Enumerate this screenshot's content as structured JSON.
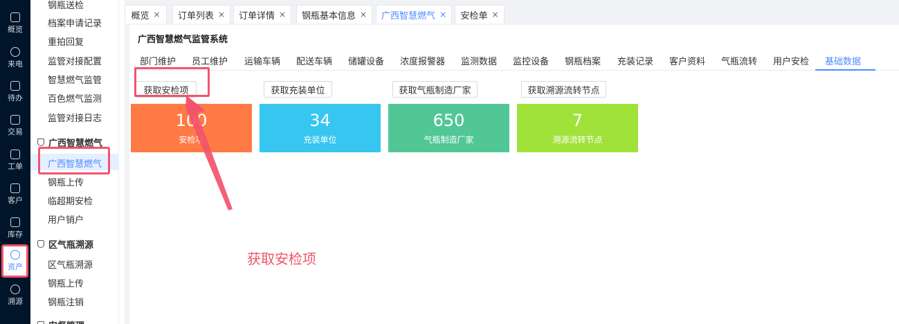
{
  "rail": {
    "items": [
      {
        "label": "概览",
        "icon": "chart-icon"
      },
      {
        "label": "来电",
        "icon": "phone-icon"
      },
      {
        "label": "待办",
        "icon": "todo-icon"
      },
      {
        "label": "交易",
        "icon": "bag-icon"
      },
      {
        "label": "工单",
        "icon": "ticket-icon"
      },
      {
        "label": "客户",
        "icon": "id-card-icon"
      },
      {
        "label": "库存",
        "icon": "inventory-icon"
      },
      {
        "label": "资产",
        "icon": "lightbulb-icon"
      },
      {
        "label": "溯源",
        "icon": "compass-icon"
      }
    ]
  },
  "submenu": {
    "top_items": [
      "钢瓶送检",
      "档案申请记录",
      "重拍回复",
      "监管对接配置",
      "智慧燃气监管",
      "百色燃气监测",
      "监管对接日志"
    ],
    "group1": {
      "title": "广西智慧燃气",
      "items": [
        "广西智慧燃气",
        "钢瓶上传",
        "临超期安检",
        "用户销户"
      ]
    },
    "group2": {
      "title": "区气瓶溯源",
      "items": [
        "区气瓶溯源",
        "钢瓶上传",
        "钢瓶注销"
      ]
    },
    "group3": {
      "title": "安督管理"
    }
  },
  "tabs": [
    {
      "label": "概览",
      "active": false
    },
    {
      "label": "订单列表",
      "active": false
    },
    {
      "label": "订单详情",
      "active": false
    },
    {
      "label": "钢瓶基本信息",
      "active": false
    },
    {
      "label": "广西智慧燃气",
      "active": true
    },
    {
      "label": "安检单",
      "active": false
    }
  ],
  "tab_close": "×",
  "panel": {
    "title": "广西智慧燃气监管系统",
    "nav": [
      "部门维护",
      "员工维护",
      "运输车辆",
      "配送车辆",
      "储罐设备",
      "浓度报警器",
      "监测数据",
      "监控设备",
      "钢瓶档案",
      "充装记录",
      "客户资料",
      "气瓶流转",
      "用户安检",
      "基础数据"
    ],
    "nav_active": "基础数据",
    "buttons": [
      "获取安检项",
      "获取充装单位",
      "获取气瓶制造厂家",
      "获取溯源流转节点"
    ],
    "cards": [
      {
        "value": "100",
        "label": "安检项",
        "color": "#ff7a45"
      },
      {
        "value": "34",
        "label": "充装单位",
        "color": "#36c6f0"
      },
      {
        "value": "650",
        "label": "气瓶制造厂家",
        "color": "#52c796"
      },
      {
        "value": "7",
        "label": "溯源流转节点",
        "color": "#a0e23a"
      }
    ]
  },
  "annotation": "获取安检项",
  "colors": {
    "accent": "#4e8cff",
    "highlight": "#f2546a",
    "rail_bg": "#001529"
  }
}
